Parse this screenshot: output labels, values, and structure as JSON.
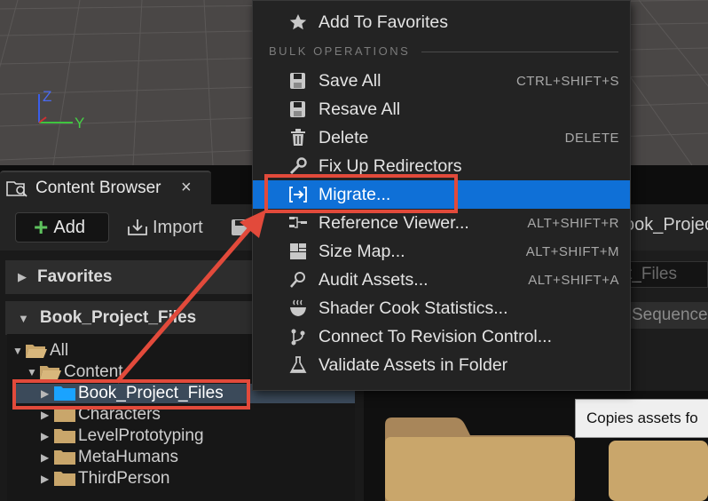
{
  "viewport": {
    "axis_z": "Z",
    "axis_y": "Y"
  },
  "content_browser": {
    "tab_title": "Content Browser",
    "tab_close": "×",
    "add_label": "Add",
    "import_label": "Import",
    "path_text": "ook_Projec",
    "search_text": "t_Files",
    "filter_text": "Sequence"
  },
  "sources": {
    "favorites_label": "Favorites",
    "project_label": "Book_Project_Files",
    "tree": [
      {
        "label": "All"
      },
      {
        "label": "Content"
      },
      {
        "label": "Book_Project_Files"
      },
      {
        "label": "Characters"
      },
      {
        "label": "LevelPrototyping"
      },
      {
        "label": "MetaHumans"
      },
      {
        "label": "ThirdPerson"
      }
    ]
  },
  "menu": {
    "add_to_favorites": "Add To Favorites",
    "section_bulk": "BULK OPERATIONS",
    "items": [
      {
        "label": "Save All",
        "shortcut": "CTRL+SHIFT+S"
      },
      {
        "label": "Resave All",
        "shortcut": ""
      },
      {
        "label": "Delete",
        "shortcut": "DELETE"
      },
      {
        "label": "Fix Up Redirectors",
        "shortcut": ""
      },
      {
        "label": "Migrate...",
        "shortcut": ""
      },
      {
        "label": "Reference Viewer...",
        "shortcut": "ALT+SHIFT+R"
      },
      {
        "label": "Size Map...",
        "shortcut": "ALT+SHIFT+M"
      },
      {
        "label": "Audit Assets...",
        "shortcut": "ALT+SHIFT+A"
      },
      {
        "label": "Shader Cook Statistics...",
        "shortcut": ""
      },
      {
        "label": "Connect To Revision Control...",
        "shortcut": ""
      },
      {
        "label": "Validate Assets in Folder",
        "shortcut": ""
      }
    ]
  },
  "tooltip": {
    "text": "Copies assets fo"
  },
  "colors": {
    "highlight": "#0f70d7",
    "annotation": "#e24a3b",
    "folder": "#c9a66b",
    "folder_selected": "#1aa3ff"
  }
}
